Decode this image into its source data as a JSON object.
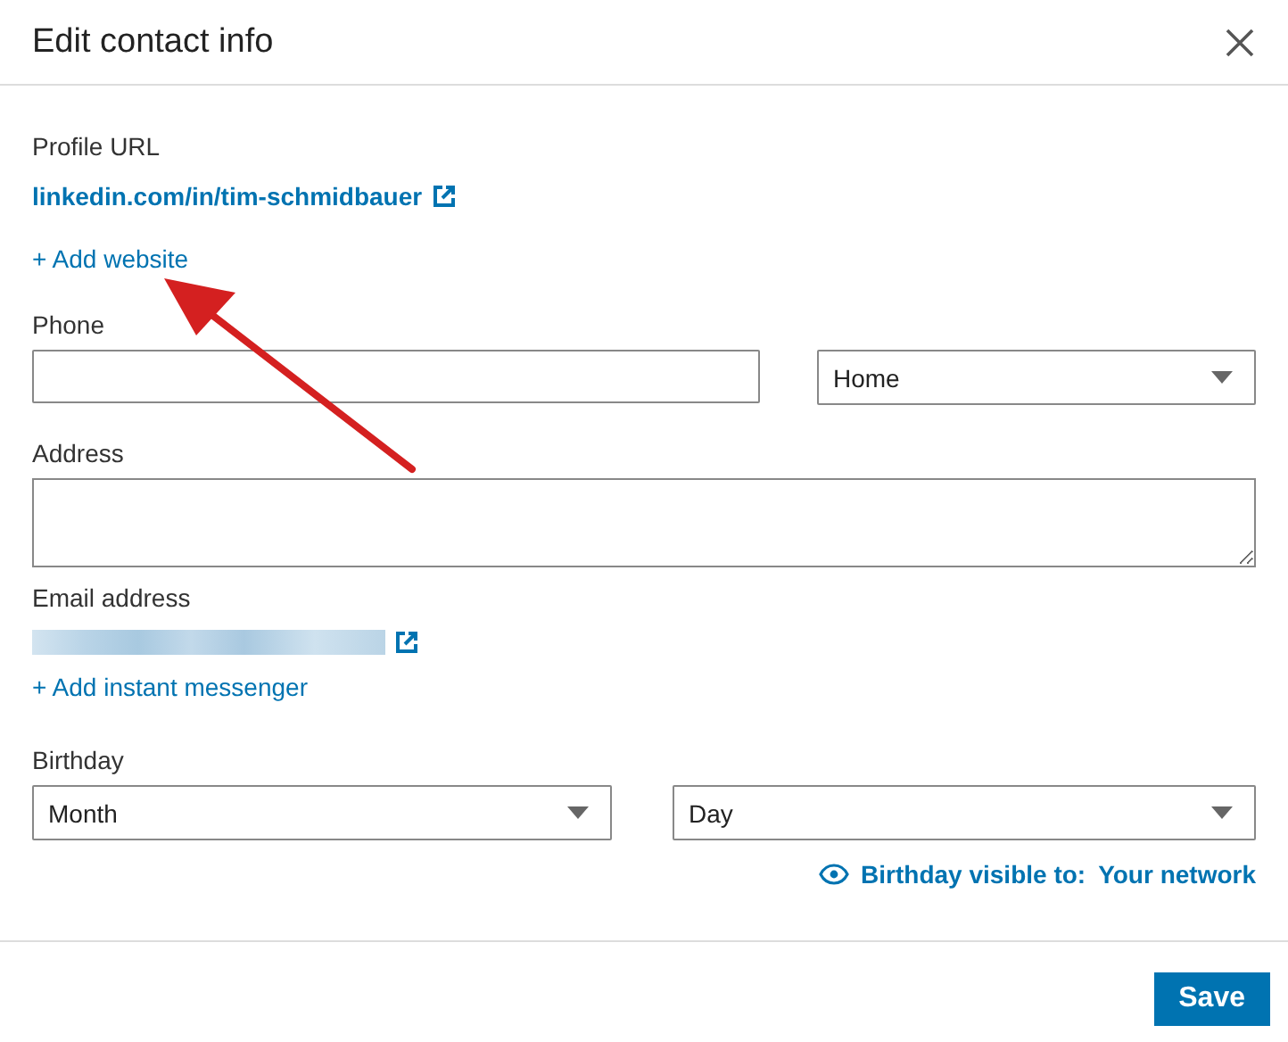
{
  "dialog": {
    "title": "Edit contact info"
  },
  "profile_url": {
    "label": "Profile URL",
    "link": "linkedin.com/in/tim-schmidbauer"
  },
  "add_website": "+ Add website",
  "phone": {
    "label": "Phone",
    "type_select": "Home"
  },
  "address": {
    "label": "Address"
  },
  "email": {
    "label": "Email address"
  },
  "add_messenger": "+ Add instant messenger",
  "birthday": {
    "label": "Birthday",
    "month": "Month",
    "day": "Day",
    "visibility_label": "Birthday visible to:",
    "visibility_value": "Your network"
  },
  "buttons": [
    "Save"
  ]
}
